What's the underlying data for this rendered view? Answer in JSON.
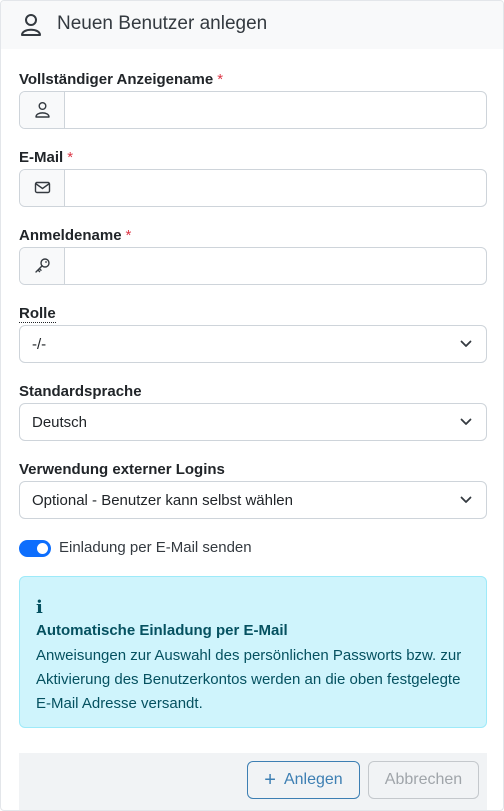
{
  "header": {
    "title": "Neuen Benutzer anlegen",
    "icon": "user-icon"
  },
  "fields": {
    "display_name": {
      "label": "Vollständiger Anzeigename",
      "required_mark": "*",
      "value": "",
      "icon": "user-icon"
    },
    "email": {
      "label": "E-Mail",
      "required_mark": "*",
      "value": "",
      "icon": "envelope-icon"
    },
    "login_name": {
      "label": "Anmeldename",
      "required_mark": "*",
      "value": "",
      "icon": "key-icon"
    },
    "role": {
      "label": "Rolle",
      "selected": "-/-"
    },
    "language": {
      "label": "Standardsprache",
      "selected": "Deutsch"
    },
    "external_logins": {
      "label": "Verwendung externer Logins",
      "selected": "Optional - Benutzer kann selbst wählen"
    }
  },
  "invite_toggle": {
    "label": "Einladung per E-Mail senden",
    "checked": true
  },
  "info_alert": {
    "icon_text": "i",
    "title": "Automatische Einladung per E-Mail",
    "text": "Anweisungen zur Auswahl des persönlichen Passworts bzw. zur Aktivierung des Benutzerkontos werden an die oben festgelegte E-Mail Adresse versandt."
  },
  "buttons": {
    "create": {
      "label": "Anlegen",
      "icon": "plus-icon"
    },
    "cancel": {
      "label": "Abbrechen"
    }
  },
  "colors": {
    "primary": "#0d6efd",
    "required": "#dc3545",
    "info_bg": "#cff4fc",
    "info_text": "#055160"
  }
}
